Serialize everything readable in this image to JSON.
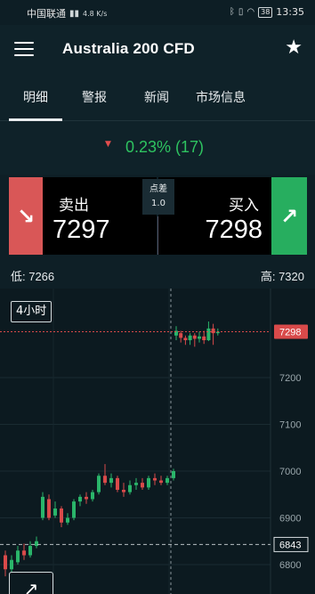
{
  "status_bar": {
    "carrier": "中国联通",
    "speed": "4.8 K/s",
    "battery": "38",
    "time": "13:35"
  },
  "header": {
    "title": "Australia 200 CFD",
    "menu_icon": "hamburger-icon",
    "favorite_icon": "star-icon"
  },
  "tabs": [
    "明细",
    "警报",
    "新闻",
    "市场信息"
  ],
  "price_change": {
    "text": "0.23% (17)",
    "direction_icon": "triangle-down-icon",
    "color": "#2ec360"
  },
  "trade": {
    "sell_label": "卖出",
    "sell_price": "7297",
    "buy_label": "买入",
    "buy_price": "7298",
    "spread_label": "点差",
    "spread_value": "1.0",
    "sell_color": "#d95757",
    "buy_color": "#27ae5f"
  },
  "range": {
    "low": "低: 7266",
    "high": "高: 7320"
  },
  "chart": {
    "timeframe": "4小时",
    "expand_icon": "arrow-up-right-icon",
    "current_price_label": "7298",
    "crosshair_price_label": "6843"
  },
  "chart_data": {
    "type": "candlestick",
    "y_ticks": [
      7200,
      7100,
      7000,
      6900,
      6800
    ],
    "current_price": 7298,
    "crosshair_price": 6843,
    "candles": [
      {
        "o": 6820,
        "c": 6790,
        "h": 6830,
        "l": 6775,
        "up": false
      },
      {
        "o": 6790,
        "c": 6810,
        "h": 6820,
        "l": 6780,
        "up": true
      },
      {
        "o": 6805,
        "c": 6830,
        "h": 6840,
        "l": 6800,
        "up": true
      },
      {
        "o": 6830,
        "c": 6820,
        "h": 6845,
        "l": 6810,
        "up": false
      },
      {
        "o": 6820,
        "c": 6840,
        "h": 6850,
        "l": 6815,
        "up": true
      },
      {
        "o": 6840,
        "c": 6850,
        "h": 6860,
        "l": 6835,
        "up": true
      },
      {
        "o": 6900,
        "c": 6945,
        "h": 6955,
        "l": 6895,
        "up": true
      },
      {
        "o": 6940,
        "c": 6900,
        "h": 6950,
        "l": 6895,
        "up": false
      },
      {
        "o": 6905,
        "c": 6920,
        "h": 6935,
        "l": 6900,
        "up": true
      },
      {
        "o": 6920,
        "c": 6890,
        "h": 6925,
        "l": 6880,
        "up": false
      },
      {
        "o": 6890,
        "c": 6900,
        "h": 6910,
        "l": 6885,
        "up": true
      },
      {
        "o": 6900,
        "c": 6935,
        "h": 6940,
        "l": 6895,
        "up": true
      },
      {
        "o": 6935,
        "c": 6945,
        "h": 6950,
        "l": 6925,
        "up": true
      },
      {
        "o": 6945,
        "c": 6940,
        "h": 6955,
        "l": 6930,
        "up": false
      },
      {
        "o": 6940,
        "c": 6955,
        "h": 6960,
        "l": 6935,
        "up": true
      },
      {
        "o": 6955,
        "c": 6990,
        "h": 6995,
        "l": 6950,
        "up": true
      },
      {
        "o": 6990,
        "c": 6975,
        "h": 7015,
        "l": 6970,
        "up": false
      },
      {
        "o": 6975,
        "c": 6985,
        "h": 6995,
        "l": 6965,
        "up": true
      },
      {
        "o": 6985,
        "c": 6960,
        "h": 6990,
        "l": 6955,
        "up": false
      },
      {
        "o": 6960,
        "c": 6955,
        "h": 6975,
        "l": 6945,
        "up": false
      },
      {
        "o": 6955,
        "c": 6970,
        "h": 6980,
        "l": 6950,
        "up": true
      },
      {
        "o": 6970,
        "c": 6975,
        "h": 6985,
        "l": 6960,
        "up": true
      },
      {
        "o": 6975,
        "c": 6965,
        "h": 6985,
        "l": 6960,
        "up": false
      },
      {
        "o": 6965,
        "c": 6985,
        "h": 6990,
        "l": 6960,
        "up": true
      },
      {
        "o": 6985,
        "c": 6980,
        "h": 6995,
        "l": 6970,
        "up": false
      },
      {
        "o": 6980,
        "c": 6975,
        "h": 6990,
        "l": 6970,
        "up": false
      },
      {
        "o": 6975,
        "c": 6985,
        "h": 6990,
        "l": 6970,
        "up": true
      },
      {
        "o": 6985,
        "c": 7000,
        "h": 7005,
        "l": 6980,
        "up": true
      },
      {
        "o": 7290,
        "c": 7300,
        "h": 7310,
        "l": 7280,
        "up": true
      },
      {
        "o": 7295,
        "c": 7285,
        "h": 7300,
        "l": 7275,
        "up": false
      },
      {
        "o": 7285,
        "c": 7280,
        "h": 7290,
        "l": 7270,
        "up": false
      },
      {
        "o": 7280,
        "c": 7290,
        "h": 7295,
        "l": 7270,
        "up": true
      },
      {
        "o": 7290,
        "c": 7283,
        "h": 7295,
        "l": 7266,
        "up": false
      },
      {
        "o": 7283,
        "c": 7288,
        "h": 7298,
        "l": 7275,
        "up": true
      },
      {
        "o": 7288,
        "c": 7280,
        "h": 7300,
        "l": 7272,
        "up": false
      },
      {
        "o": 7280,
        "c": 7305,
        "h": 7320,
        "l": 7278,
        "up": true
      },
      {
        "o": 7305,
        "c": 7295,
        "h": 7315,
        "l": 7270,
        "up": false
      },
      {
        "o": 7295,
        "c": 7298,
        "h": 7305,
        "l": 7290,
        "up": true
      }
    ]
  }
}
